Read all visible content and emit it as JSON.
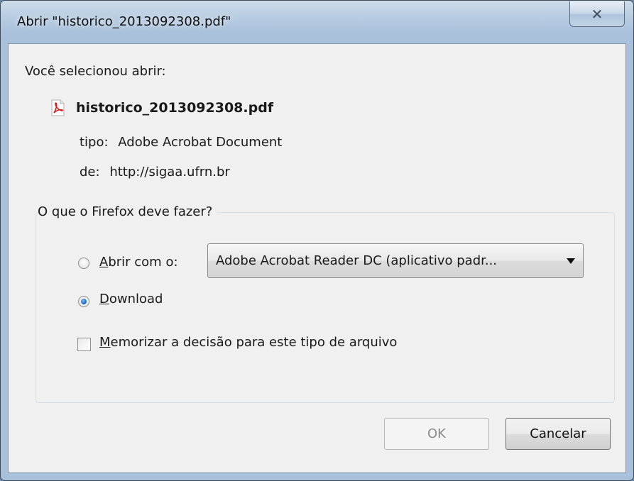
{
  "window": {
    "title": "Abrir \"historico_2013092308.pdf\"",
    "close_icon": "close-icon"
  },
  "prompt": "Você selecionou abrir:",
  "file": {
    "name": "historico_2013092308.pdf",
    "icon": "pdf-file-icon",
    "type_key": "tipo:",
    "type_value": "Adobe Acrobat Document",
    "from_key": "de:",
    "from_value": "http://sigaa.ufrn.br"
  },
  "action_group": {
    "legend": "O que o Firefox deve fazer?",
    "open_with": {
      "mnemonic": "A",
      "label_rest": "brir com o:",
      "selected": false
    },
    "app_select": {
      "value": "Adobe Acrobat Reader DC  (aplicativo padr..."
    },
    "download": {
      "mnemonic": "D",
      "label_rest": "ownload",
      "selected": true
    },
    "remember": {
      "mnemonic": "M",
      "label_rest": "emorizar a decisão para este tipo de arquivo",
      "checked": false
    }
  },
  "buttons": {
    "ok": "OK",
    "cancel": "Cancelar"
  },
  "colors": {
    "titlebar": "#b9cde2",
    "client_bg": "#f0f0f0",
    "radio_selected": "#1f6fc4",
    "pdf_red": "#d02020"
  }
}
